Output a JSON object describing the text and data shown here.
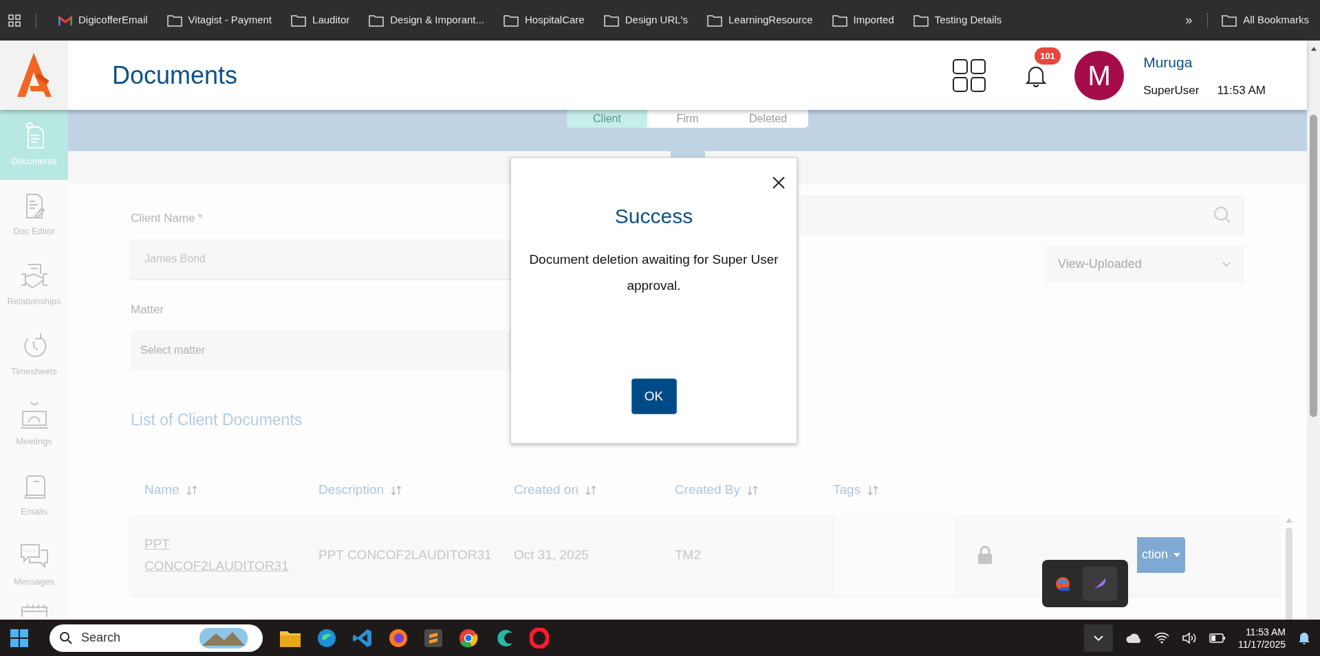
{
  "bookmarks_bar": {
    "items": [
      {
        "label": "DigicofferEmail",
        "kind": "mail"
      },
      {
        "label": "Vitagist - Payment",
        "kind": "folder"
      },
      {
        "label": "Lauditor",
        "kind": "folder"
      },
      {
        "label": "Design & Imporant...",
        "kind": "folder"
      },
      {
        "label": "HospitalCare",
        "kind": "folder"
      },
      {
        "label": "Design URL's",
        "kind": "folder"
      },
      {
        "label": "LearningResource",
        "kind": "folder"
      },
      {
        "label": "Imported",
        "kind": "folder"
      },
      {
        "label": "Testing Details",
        "kind": "folder"
      }
    ],
    "more": "»",
    "all_bookmarks": "All Bookmarks"
  },
  "header": {
    "title": "Documents",
    "notification_count": "101",
    "avatar_initial": "M",
    "user_name": "Muruga",
    "role": "SuperUser",
    "time": "11:53 AM"
  },
  "sidebar": {
    "items": [
      {
        "label": "Documents",
        "selected": true
      },
      {
        "label": "Doc Editor",
        "selected": false
      },
      {
        "label": "Relationships",
        "selected": false
      },
      {
        "label": "Timesheets",
        "selected": false
      },
      {
        "label": "Meetings",
        "selected": false
      },
      {
        "label": "Emails",
        "selected": false
      },
      {
        "label": "Messages",
        "selected": false
      }
    ]
  },
  "tabs": [
    {
      "label": "Client",
      "selected": true
    },
    {
      "label": "Firm",
      "selected": false
    },
    {
      "label": "Deleted",
      "selected": false
    }
  ],
  "form": {
    "client_name_label": "Client Name",
    "required_mark": "*",
    "client_name_value": "James Bond",
    "matter_label": "Matter",
    "matter_placeholder": "Select matter",
    "view_select": "View-Uploaded"
  },
  "list_title": "List of Client Documents",
  "table": {
    "columns": [
      "Name",
      "Description",
      "Created on",
      "Created By",
      "Tags"
    ],
    "rows": [
      {
        "name": "PPT CONCOF2LAUDITOR31",
        "description": "PPT CONCOF2LAUDITOR31",
        "created_on": "Oct 31, 2025",
        "created_by": "TM2",
        "action": "ction"
      }
    ]
  },
  "dialog": {
    "title": "Success",
    "message": "Document deletion awaiting for Super User approval.",
    "ok": "OK"
  },
  "taskbar": {
    "search_placeholder": "Search",
    "time": "11:53 AM",
    "date": "11/17/2025"
  }
}
